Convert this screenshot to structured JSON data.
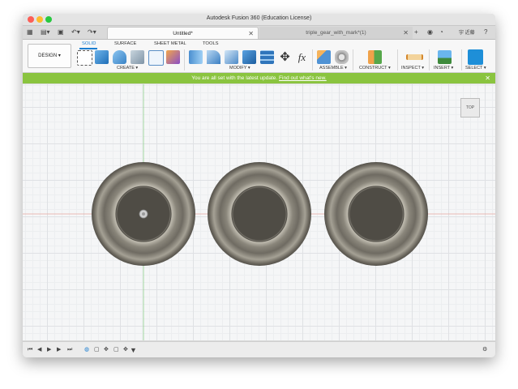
{
  "window": {
    "title": "Autodesk Fusion 360 (Education License)"
  },
  "tabs": [
    {
      "label": "Untitled*",
      "active": true
    },
    {
      "label": "triple_gear_with_mark*(1)",
      "active": false
    }
  ],
  "user": {
    "label": "宇 近藤"
  },
  "toolbar": {
    "workspace": "DESIGN ▾",
    "workspace_tabs": [
      "SOLID",
      "SURFACE",
      "SHEET METAL",
      "TOOLS"
    ],
    "groups": [
      "CREATE ▾",
      "MODIFY ▾",
      "ASSEMBLE ▾",
      "CONSTRUCT ▾",
      "INSPECT ▾",
      "INSERT ▾",
      "SELECT ▾"
    ],
    "fx_label": "fx"
  },
  "banner": {
    "text": "You are all set with the latest update.",
    "link": "Find out what's new.",
    "close": "✕",
    "color": "#8ac43f"
  },
  "viewcube": {
    "label": "TOP"
  },
  "canvas": {
    "tori_count": 3,
    "model_color": "#8e8a7f",
    "axis_red": "#e8a79f",
    "axis_green": "#8fd08a"
  }
}
